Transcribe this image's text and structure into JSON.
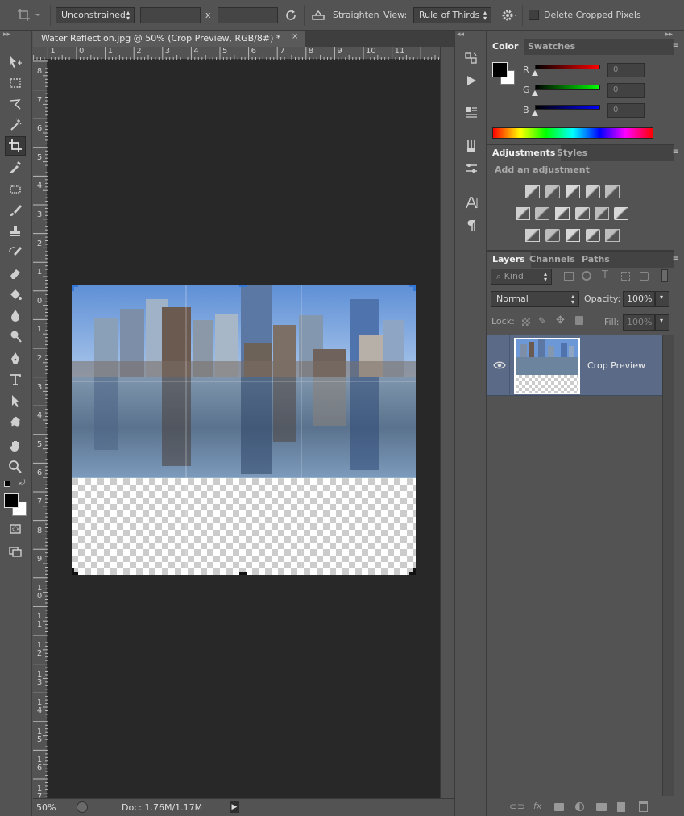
{
  "options": {
    "ratio_label": "Unconstrained",
    "x_label": "x",
    "straighten_label": "Straighten",
    "view_label": "View:",
    "view_value": "Rule of Thirds",
    "delete_cropped_label": "Delete Cropped Pixels"
  },
  "document": {
    "tab_title": "Water Reflection.jpg @ 50% (Crop Preview, RGB/8#) *",
    "close_glyph": "×",
    "ruler_top": [
      "1",
      "0",
      "1",
      "2",
      "3",
      "4",
      "5",
      "6",
      "7",
      "8",
      "9",
      "10",
      "11"
    ],
    "ruler_left": [
      "8",
      "7",
      "6",
      "5",
      "4",
      "3",
      "2",
      "1",
      "0",
      "1",
      "2",
      "3",
      "4",
      "5",
      "6",
      "7",
      "8",
      "9",
      "1 0",
      "1 1",
      "1 2",
      "1 3",
      "1 4",
      "1 5",
      "1 6",
      "1 7"
    ]
  },
  "status": {
    "zoom": "50%",
    "doc_info": "Doc: 1.76M/1.17M"
  },
  "color_panel": {
    "tabs": [
      "Color",
      "Swatches"
    ],
    "labels": [
      "R",
      "G",
      "B"
    ],
    "values": [
      "0",
      "0",
      "0"
    ]
  },
  "adjustments_panel": {
    "tabs": [
      "Adjustments",
      "Styles"
    ],
    "heading": "Add an adjustment"
  },
  "layers_panel": {
    "tabs": [
      "Layers",
      "Channels",
      "Paths"
    ],
    "kind_label": "Kind",
    "blend_mode": "Normal",
    "opacity_label": "Opacity:",
    "opacity_value": "100%",
    "lock_label": "Lock:",
    "fill_label": "Fill:",
    "fill_value": "100%",
    "layer_name": "Crop Preview"
  },
  "colors": {
    "ui_bg": "#535353",
    "canvas_bg": "#282828",
    "layer_selected": "#5b6b87",
    "crop_handle": "#3478d8"
  }
}
